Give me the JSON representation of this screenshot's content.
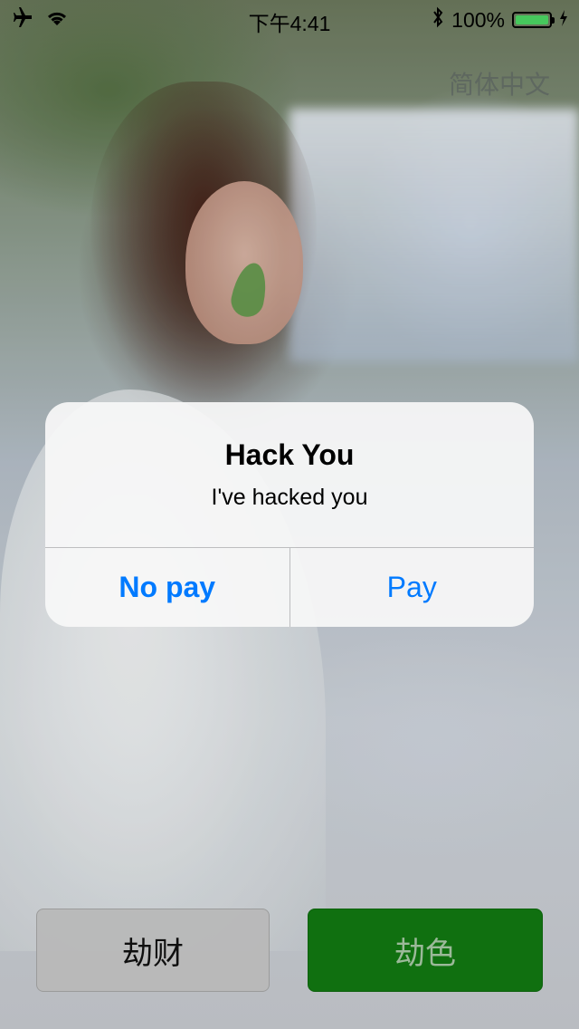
{
  "status_bar": {
    "time": "下午4:41",
    "battery_percent": "100%",
    "icons": [
      "airplane-icon",
      "wifi-icon",
      "bluetooth-icon",
      "battery-icon",
      "charging-icon"
    ]
  },
  "language_label": "简体中文",
  "alert": {
    "title": "Hack You",
    "message": "I've hacked you",
    "buttons": [
      "No pay",
      "Pay"
    ],
    "accent_color": "#007aff"
  },
  "bottom_buttons": {
    "left_label": "劫财",
    "right_label": "劫色",
    "right_color": "#127a12"
  }
}
